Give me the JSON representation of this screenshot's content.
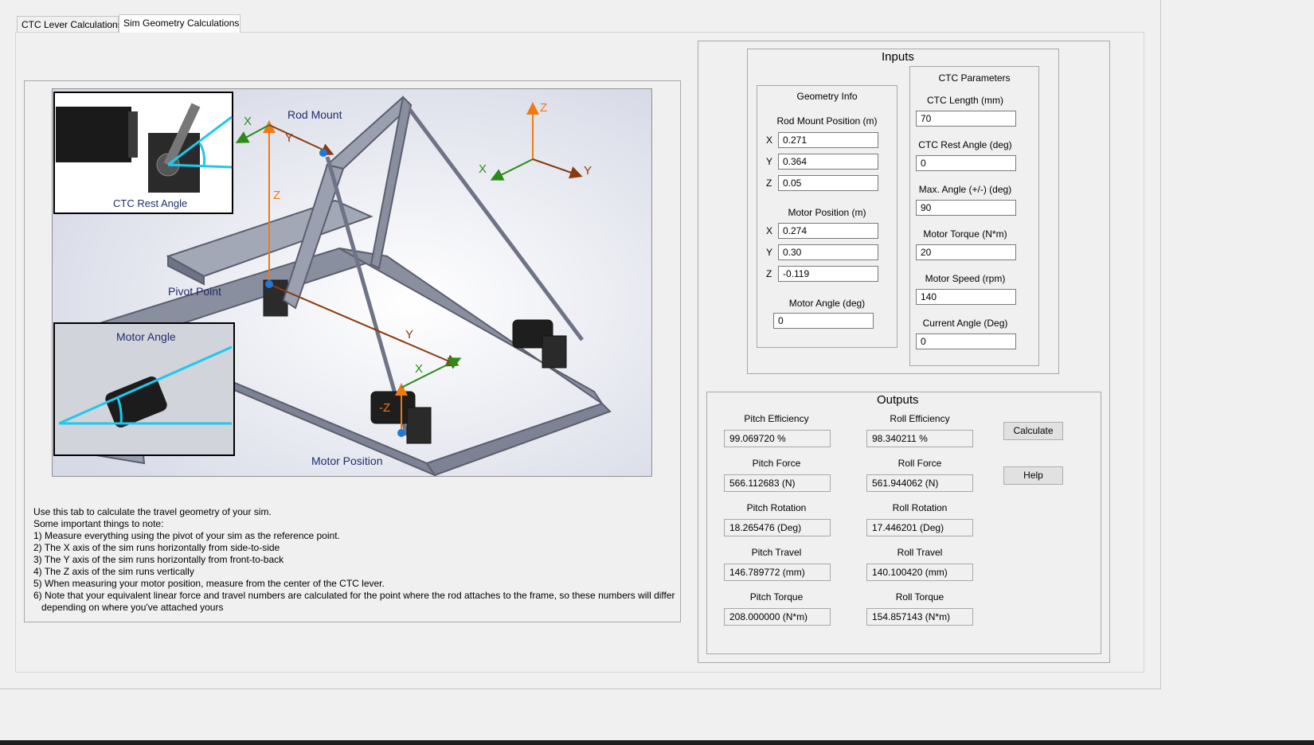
{
  "tabs": [
    "CTC Lever Calculations",
    "Sim Geometry Calculations"
  ],
  "diagram": {
    "insets": {
      "ctc_rest_angle": "CTC Rest Angle",
      "motor_angle": "Motor Angle"
    },
    "labels": {
      "rod_mount": "Rod Mount",
      "pivot_point": "Pivot Point",
      "motor_position": "Motor Position",
      "x": "X",
      "y": "Y",
      "z": "Z",
      "neg_z": "-Z"
    },
    "colors": {
      "orange": "#f07a12",
      "brown": "#8b3a0e",
      "green": "#2a8a1a",
      "cyan": "#1ec8ee",
      "navy": "#1f2d6b",
      "blue": "#1e78d8"
    }
  },
  "notes": [
    "Use this tab to calculate the travel geometry of your sim.",
    "Some important things to note:",
    "1) Measure everything using the pivot of your sim as the reference point.",
    "2) The X axis of the sim runs horizontally from side-to-side",
    "3) The Y axis of the sim runs horizontally from front-to-back",
    "4) The Z axis of the sim runs vertically",
    "5) When measuring your motor position, measure from the center of the CTC lever.",
    "6) Note that your equivalent linear force and travel numbers are calculated for the point where the rod attaches to the frame, so these numbers will differ",
    "   depending on where you've attached yours"
  ],
  "inputs": {
    "title": "Inputs",
    "geometry": {
      "title": "Geometry Info",
      "rod_mount": {
        "label": "Rod Mount Position (m)",
        "x": "0.271",
        "y": "0.364",
        "z": "0.05"
      },
      "motor_pos": {
        "label": "Motor Position (m)",
        "x": "0.274",
        "y": "0.30",
        "z": "-0.119"
      },
      "axis_x": "X",
      "axis_y": "Y",
      "axis_z": "Z",
      "motor_angle": {
        "label": "Motor Angle (deg)",
        "value": "0"
      }
    },
    "ctc": {
      "title": "CTC Parameters",
      "fields": [
        {
          "label": "CTC Length (mm)",
          "value": "70"
        },
        {
          "label": "CTC Rest Angle (deg)",
          "value": "0"
        },
        {
          "label": "Max. Angle (+/-) (deg)",
          "value": "90"
        },
        {
          "label": "Motor Torque (N*m)",
          "value": "20"
        },
        {
          "label": "Motor Speed (rpm)",
          "value": "140"
        },
        {
          "label": "Current Angle (Deg)",
          "value": "0"
        }
      ]
    }
  },
  "outputs": {
    "title": "Outputs",
    "pitch": [
      {
        "label": "Pitch Efficiency",
        "value": "99.069720   %"
      },
      {
        "label": "Pitch Force",
        "value": "566.112683   (N)"
      },
      {
        "label": "Pitch Rotation",
        "value": "18.265476   (Deg)"
      },
      {
        "label": "Pitch Travel",
        "value": "146.789772   (mm)"
      },
      {
        "label": "Pitch Torque",
        "value": "208.000000   (N*m)"
      }
    ],
    "roll": [
      {
        "label": "Roll Efficiency",
        "value": "98.340211   %"
      },
      {
        "label": "Roll Force",
        "value": "561.944062   (N)"
      },
      {
        "label": "Roll Rotation",
        "value": "17.446201   (Deg)"
      },
      {
        "label": "Roll Travel",
        "value": "140.100420   (mm)"
      },
      {
        "label": "Roll Torque",
        "value": "154.857143   (N*m)"
      }
    ],
    "calculate_label": "Calculate",
    "help_label": "Help"
  }
}
